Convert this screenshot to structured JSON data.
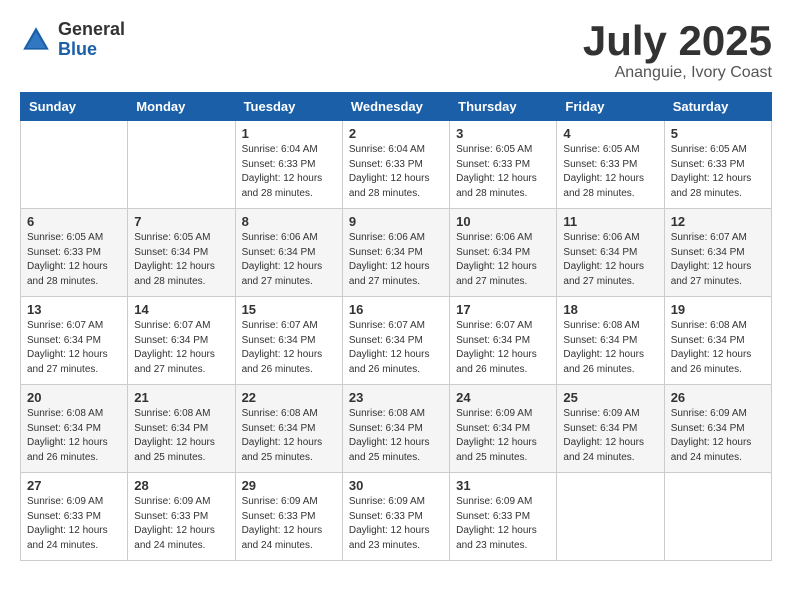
{
  "logo": {
    "general": "General",
    "blue": "Blue"
  },
  "title": {
    "month_year": "July 2025",
    "location": "Ananguie, Ivory Coast"
  },
  "days_of_week": [
    "Sunday",
    "Monday",
    "Tuesday",
    "Wednesday",
    "Thursday",
    "Friday",
    "Saturday"
  ],
  "weeks": [
    [
      {
        "day": "",
        "info": ""
      },
      {
        "day": "",
        "info": ""
      },
      {
        "day": "1",
        "info": "Sunrise: 6:04 AM\nSunset: 6:33 PM\nDaylight: 12 hours and 28 minutes."
      },
      {
        "day": "2",
        "info": "Sunrise: 6:04 AM\nSunset: 6:33 PM\nDaylight: 12 hours and 28 minutes."
      },
      {
        "day": "3",
        "info": "Sunrise: 6:05 AM\nSunset: 6:33 PM\nDaylight: 12 hours and 28 minutes."
      },
      {
        "day": "4",
        "info": "Sunrise: 6:05 AM\nSunset: 6:33 PM\nDaylight: 12 hours and 28 minutes."
      },
      {
        "day": "5",
        "info": "Sunrise: 6:05 AM\nSunset: 6:33 PM\nDaylight: 12 hours and 28 minutes."
      }
    ],
    [
      {
        "day": "6",
        "info": "Sunrise: 6:05 AM\nSunset: 6:33 PM\nDaylight: 12 hours and 28 minutes."
      },
      {
        "day": "7",
        "info": "Sunrise: 6:05 AM\nSunset: 6:34 PM\nDaylight: 12 hours and 28 minutes."
      },
      {
        "day": "8",
        "info": "Sunrise: 6:06 AM\nSunset: 6:34 PM\nDaylight: 12 hours and 27 minutes."
      },
      {
        "day": "9",
        "info": "Sunrise: 6:06 AM\nSunset: 6:34 PM\nDaylight: 12 hours and 27 minutes."
      },
      {
        "day": "10",
        "info": "Sunrise: 6:06 AM\nSunset: 6:34 PM\nDaylight: 12 hours and 27 minutes."
      },
      {
        "day": "11",
        "info": "Sunrise: 6:06 AM\nSunset: 6:34 PM\nDaylight: 12 hours and 27 minutes."
      },
      {
        "day": "12",
        "info": "Sunrise: 6:07 AM\nSunset: 6:34 PM\nDaylight: 12 hours and 27 minutes."
      }
    ],
    [
      {
        "day": "13",
        "info": "Sunrise: 6:07 AM\nSunset: 6:34 PM\nDaylight: 12 hours and 27 minutes."
      },
      {
        "day": "14",
        "info": "Sunrise: 6:07 AM\nSunset: 6:34 PM\nDaylight: 12 hours and 27 minutes."
      },
      {
        "day": "15",
        "info": "Sunrise: 6:07 AM\nSunset: 6:34 PM\nDaylight: 12 hours and 26 minutes."
      },
      {
        "day": "16",
        "info": "Sunrise: 6:07 AM\nSunset: 6:34 PM\nDaylight: 12 hours and 26 minutes."
      },
      {
        "day": "17",
        "info": "Sunrise: 6:07 AM\nSunset: 6:34 PM\nDaylight: 12 hours and 26 minutes."
      },
      {
        "day": "18",
        "info": "Sunrise: 6:08 AM\nSunset: 6:34 PM\nDaylight: 12 hours and 26 minutes."
      },
      {
        "day": "19",
        "info": "Sunrise: 6:08 AM\nSunset: 6:34 PM\nDaylight: 12 hours and 26 minutes."
      }
    ],
    [
      {
        "day": "20",
        "info": "Sunrise: 6:08 AM\nSunset: 6:34 PM\nDaylight: 12 hours and 26 minutes."
      },
      {
        "day": "21",
        "info": "Sunrise: 6:08 AM\nSunset: 6:34 PM\nDaylight: 12 hours and 25 minutes."
      },
      {
        "day": "22",
        "info": "Sunrise: 6:08 AM\nSunset: 6:34 PM\nDaylight: 12 hours and 25 minutes."
      },
      {
        "day": "23",
        "info": "Sunrise: 6:08 AM\nSunset: 6:34 PM\nDaylight: 12 hours and 25 minutes."
      },
      {
        "day": "24",
        "info": "Sunrise: 6:09 AM\nSunset: 6:34 PM\nDaylight: 12 hours and 25 minutes."
      },
      {
        "day": "25",
        "info": "Sunrise: 6:09 AM\nSunset: 6:34 PM\nDaylight: 12 hours and 24 minutes."
      },
      {
        "day": "26",
        "info": "Sunrise: 6:09 AM\nSunset: 6:34 PM\nDaylight: 12 hours and 24 minutes."
      }
    ],
    [
      {
        "day": "27",
        "info": "Sunrise: 6:09 AM\nSunset: 6:33 PM\nDaylight: 12 hours and 24 minutes."
      },
      {
        "day": "28",
        "info": "Sunrise: 6:09 AM\nSunset: 6:33 PM\nDaylight: 12 hours and 24 minutes."
      },
      {
        "day": "29",
        "info": "Sunrise: 6:09 AM\nSunset: 6:33 PM\nDaylight: 12 hours and 24 minutes."
      },
      {
        "day": "30",
        "info": "Sunrise: 6:09 AM\nSunset: 6:33 PM\nDaylight: 12 hours and 23 minutes."
      },
      {
        "day": "31",
        "info": "Sunrise: 6:09 AM\nSunset: 6:33 PM\nDaylight: 12 hours and 23 minutes."
      },
      {
        "day": "",
        "info": ""
      },
      {
        "day": "",
        "info": ""
      }
    ]
  ]
}
